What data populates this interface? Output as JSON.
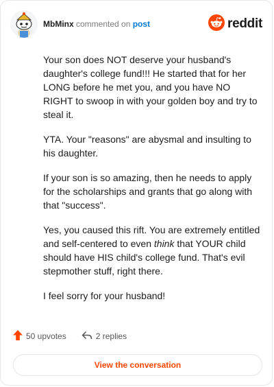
{
  "header": {
    "username": "MbMinx",
    "action_text": " commented on ",
    "post_link": "post",
    "brand_name": "reddit",
    "avatar_icon": "snoo-avatar-icon",
    "brand_icon": "reddit-logo-icon"
  },
  "comment": {
    "paragraphs": [
      "Your son does NOT deserve your husband's daughter's college fund!!! He started that for her LONG before he met you, and you have NO RIGHT to swoop in with your golden boy and try to steal it.",
      "YTA. Your \"reasons\" are abysmal and insulting to his daughter.",
      "If your son is so amazing, then he needs to apply for the scholarships and grants that go along with that \"success\".",
      "Yes, you caused this rift. You are extremely entitled and self-centered to even ",
      "I feel sorry for your husband!"
    ],
    "p4_emphasis": "think",
    "p4_rest": " that YOUR child should have HIS child's college fund. That's evil stepmother stuff, right there."
  },
  "footer": {
    "upvotes_label": "50 upvotes",
    "replies_label": "2 replies",
    "upvote_icon": "upvote-arrow-icon",
    "reply_icon": "reply-arrow-icon",
    "view_button_label": "View the conversation"
  },
  "colors": {
    "accent": "#ff4500",
    "link": "#0079d3",
    "text": "#1c1c1c",
    "muted": "#7c7c7c",
    "border": "#e4e6e8"
  }
}
